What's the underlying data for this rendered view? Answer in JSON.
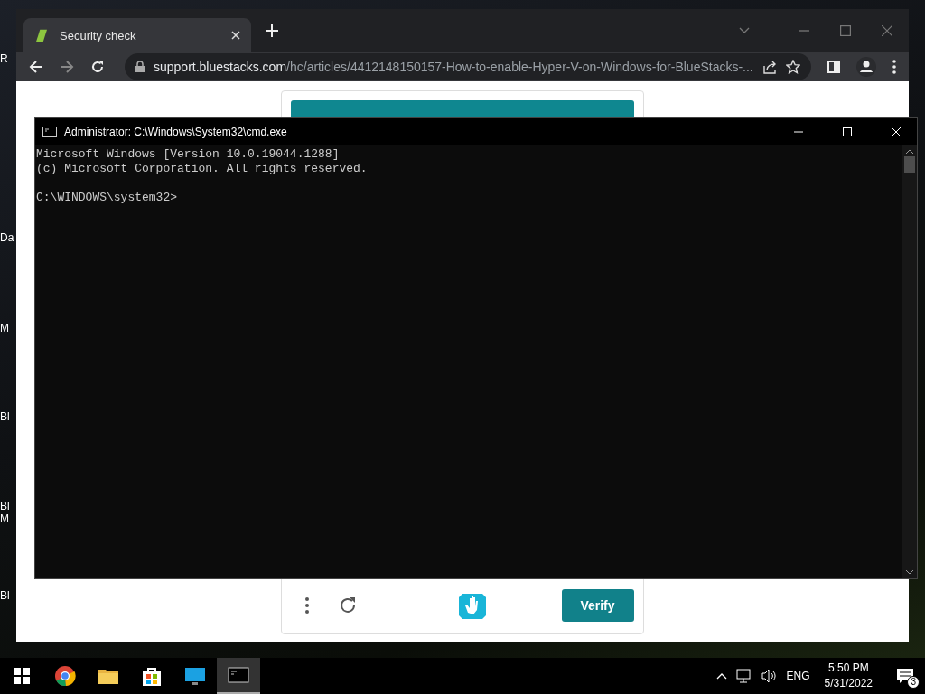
{
  "desktop_icons": [
    {
      "label": "R"
    },
    {
      "label": "Da"
    },
    {
      "label": "M"
    },
    {
      "label": "Bl"
    },
    {
      "label": "Bl\nM"
    },
    {
      "label": "Bl"
    }
  ],
  "browser": {
    "tab": {
      "title": "Security check",
      "selected": true
    },
    "address": {
      "domain": "support.bluestacks.com",
      "path": "/hc/articles/4412148150157-How-to-enable-Hyper-V-on-Windows-for-BlueStacks-..."
    },
    "captcha": {
      "verify_button": "Verify"
    }
  },
  "console": {
    "title": "Administrator: C:\\Windows\\System32\\cmd.exe",
    "lines": [
      "Microsoft Windows [Version 10.0.19044.1288]",
      "(c) Microsoft Corporation. All rights reserved."
    ],
    "prompt": "C:\\WINDOWS\\system32>"
  },
  "taskbar": {
    "apps": [
      {
        "kind": "chrome",
        "active": false
      },
      {
        "kind": "folder",
        "active": false
      },
      {
        "kind": "store",
        "active": false
      },
      {
        "kind": "monitor",
        "active": false
      },
      {
        "kind": "console",
        "active": true
      }
    ],
    "language": "ENG",
    "time": "5:50 PM",
    "date": "5/31/2022",
    "notifications": "3"
  }
}
